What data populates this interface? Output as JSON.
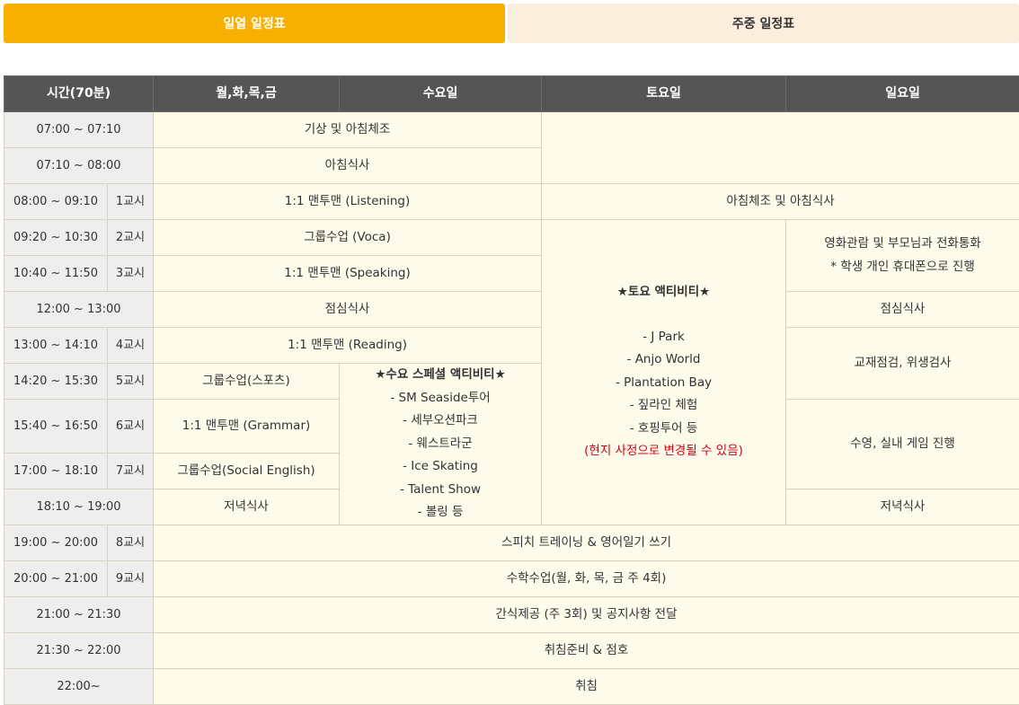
{
  "tabs": {
    "active": "일열 일정표",
    "inactive": "주중 일정표"
  },
  "headers": {
    "time": "시간(70분)",
    "mtwf": "월,화,목,금",
    "wed": "수요일",
    "sat": "토요일",
    "sun": "일요일"
  },
  "rows": {
    "r1": {
      "time": "07:00 ~ 07:10",
      "weekday": "기상 및 아침체조"
    },
    "r2": {
      "time": "07:10 ~ 08:00",
      "weekday": "아침식사"
    },
    "r3": {
      "time": "08:00 ~ 09:10",
      "period": "1교시",
      "weekday": "1:1 맨투맨 (Listening)",
      "weekend": "아침체조 및 아침식사"
    },
    "r4": {
      "time": "09:20 ~ 10:30",
      "period": "2교시",
      "weekday": "그룹수업 (Voca)"
    },
    "r5": {
      "time": "10:40 ~ 11:50",
      "period": "3교시",
      "weekday": "1:1 맨투맨 (Speaking)"
    },
    "r6": {
      "time": "12:00 ~ 13:00",
      "weekday": "점심식사",
      "sun": "점심식사"
    },
    "r7": {
      "time": "13:00 ~ 14:10",
      "period": "4교시",
      "weekday": "1:1 맨투맨 (Reading)"
    },
    "r8": {
      "time": "14:20 ~ 15:30",
      "period": "5교시",
      "mtwf": "그룹수업(스포츠)"
    },
    "r9": {
      "time": "15:40 ~ 16:50",
      "period": "6교시",
      "mtwf": "1:1 맨투맨 (Grammar)"
    },
    "r10": {
      "time": "17:00 ~ 18:10",
      "period": "7교시",
      "mtwf": "그룹수업(Social English)"
    },
    "r11": {
      "time": "18:10 ~ 19:00",
      "mtwf": "저녁식사",
      "sun": "저녁식사"
    },
    "r12": {
      "time": "19:00 ~ 20:00",
      "period": "8교시",
      "all": "스피치 트레이닝 & 영어일기 쓰기"
    },
    "r13": {
      "time": "20:00 ~ 21:00",
      "period": "9교시",
      "all": "수학수업(월, 화, 목, 금 주 4회)"
    },
    "r14": {
      "time": "21:00 ~ 21:30",
      "all": "간식제공 (주 3회) 및 공지사항 전달"
    },
    "r15": {
      "time": "21:30 ~ 22:00",
      "all": "취침준비 & 점호"
    },
    "r16": {
      "time": "22:00~",
      "all": "취침"
    }
  },
  "sun_blocks": {
    "movie": "영화관람 및 부모님과 전화통화",
    "movie_note": "* 학생 개인 휴대폰으로 진행",
    "check": "교재점검, 위생검사",
    "swim": "수영, 실내 게임 진행"
  },
  "sat_activity": {
    "title": "★토요 액티비티★",
    "items": [
      "- J Park",
      "- Anjo World",
      "- Plantation Bay",
      "- 짚라인 체험",
      "- 호핑투어 등"
    ],
    "note": "(현지 사정으로 변경될 수 있음)"
  },
  "wed_activity": {
    "title": "★수요 스페셜 액티비티★",
    "items": [
      "- SM Seaside투어",
      "- 세부오션파크",
      "- 웨스트라군",
      "- Ice Skating",
      "- Talent Show",
      "- 볼링 등"
    ]
  }
}
